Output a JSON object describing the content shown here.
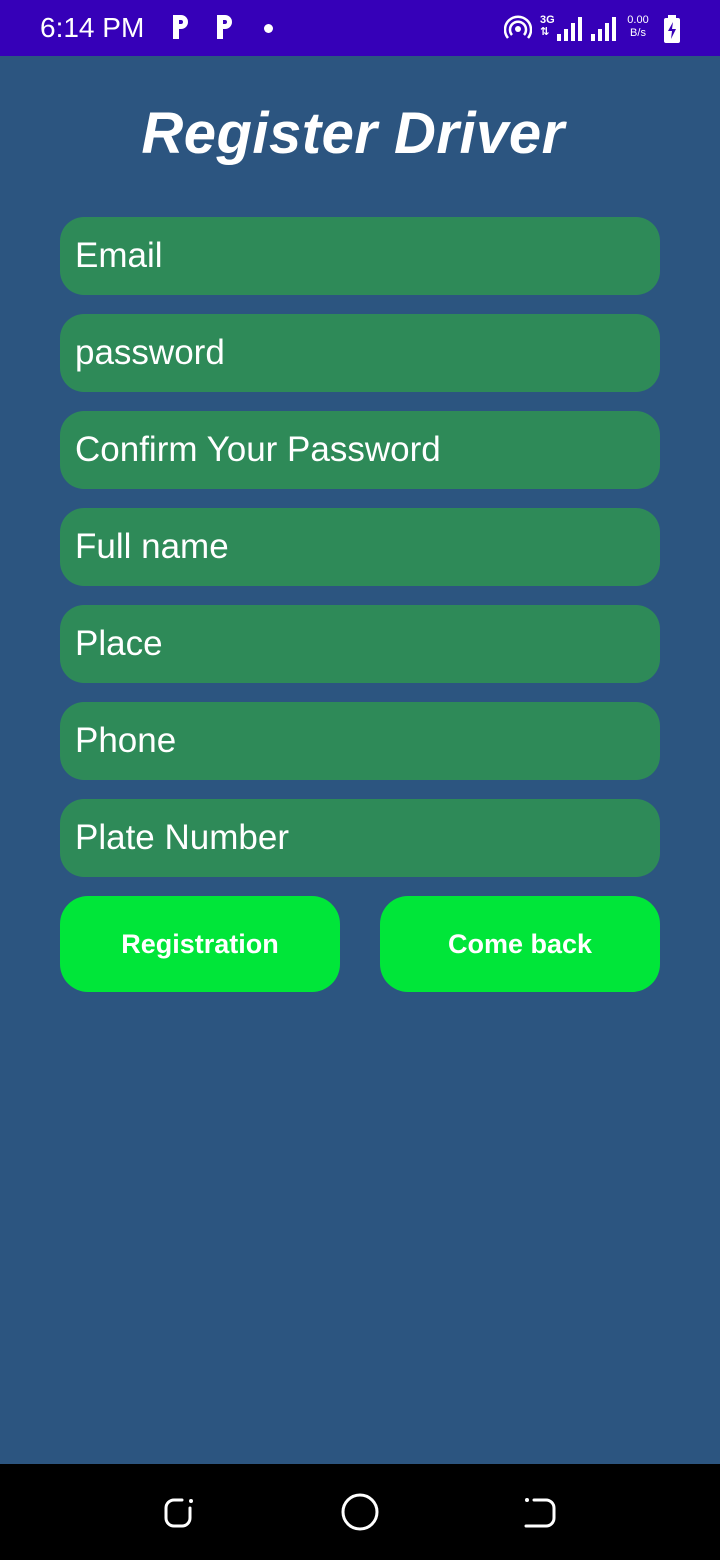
{
  "status_bar": {
    "time": "6:14 PM",
    "app_icons": [
      "p-app-icon",
      "p-app-icon"
    ],
    "network_type": "3G",
    "network_type_sub": "⇅",
    "speed_value": "0.00",
    "speed_unit": "B/s",
    "background": "#3600b8"
  },
  "page": {
    "title": "Register Driver",
    "background": "#2c5580"
  },
  "form": {
    "fields": [
      {
        "name": "email",
        "placeholder": "Email",
        "value": ""
      },
      {
        "name": "password",
        "placeholder": "password",
        "value": ""
      },
      {
        "name": "confirm_password",
        "placeholder": "Confirm Your Password",
        "value": ""
      },
      {
        "name": "full_name",
        "placeholder": "Full name",
        "value": ""
      },
      {
        "name": "place",
        "placeholder": "Place",
        "value": ""
      },
      {
        "name": "phone",
        "placeholder": "Phone",
        "value": ""
      },
      {
        "name": "plate_number",
        "placeholder": "Plate Number",
        "value": ""
      }
    ],
    "field_color": "#2e8a58",
    "registration_label": "Registration",
    "come_back_label": "Come back",
    "button_color": "#00e639"
  },
  "nav_bar": {
    "icons": [
      "recent-apps-icon",
      "home-icon",
      "back-icon"
    ]
  }
}
